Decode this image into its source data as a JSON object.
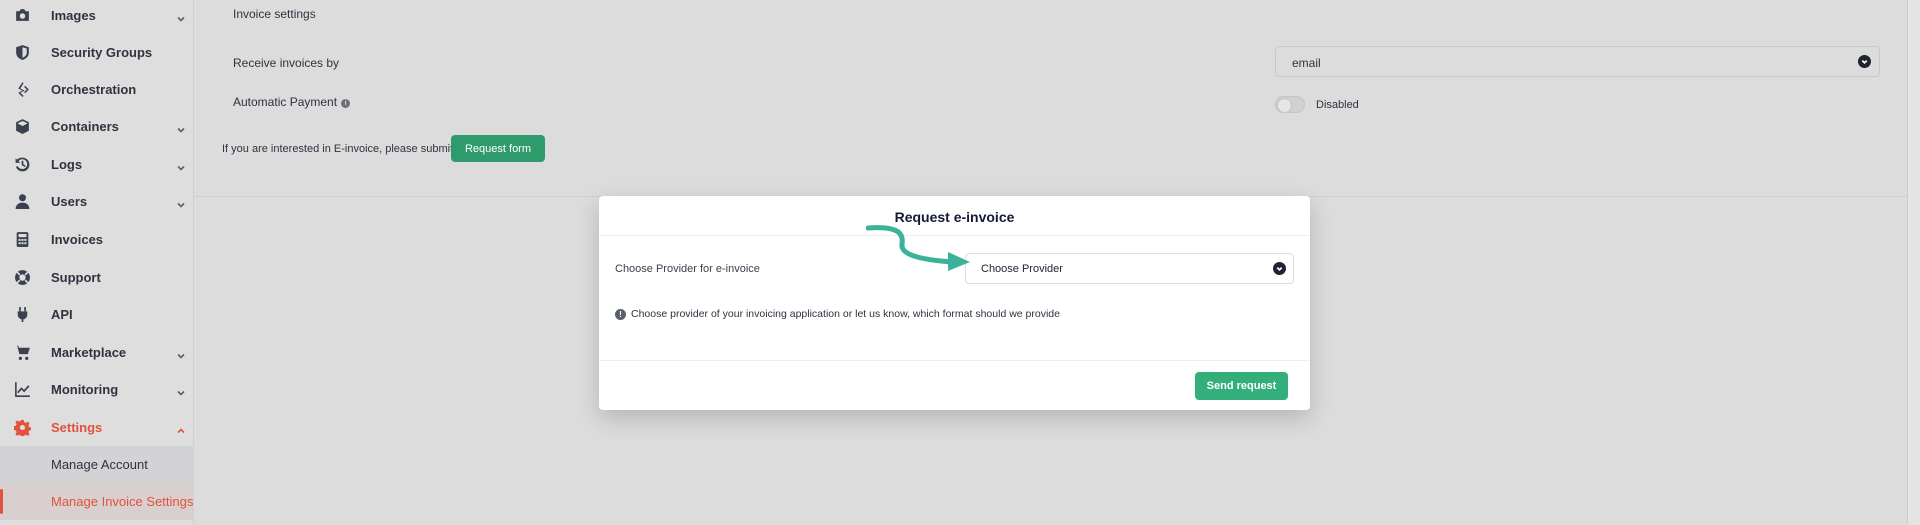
{
  "sidebar": {
    "items": [
      {
        "label": "Images",
        "icon": "camera-icon",
        "has_chevron": true
      },
      {
        "label": "Security Groups",
        "icon": "shield-icon",
        "has_chevron": false
      },
      {
        "label": "Orchestration",
        "icon": "orchestration-icon",
        "has_chevron": false
      },
      {
        "label": "Containers",
        "icon": "cube-icon",
        "has_chevron": true
      },
      {
        "label": "Logs",
        "icon": "history-icon",
        "has_chevron": true
      },
      {
        "label": "Users",
        "icon": "user-icon",
        "has_chevron": true
      },
      {
        "label": "Invoices",
        "icon": "calculator-icon",
        "has_chevron": false
      },
      {
        "label": "Support",
        "icon": "lifebuoy-icon",
        "has_chevron": false
      },
      {
        "label": "API",
        "icon": "plug-icon",
        "has_chevron": false
      },
      {
        "label": "Marketplace",
        "icon": "cart-icon",
        "has_chevron": true
      },
      {
        "label": "Monitoring",
        "icon": "chart-line-icon",
        "has_chevron": true
      },
      {
        "label": "Settings",
        "icon": "gear-icon",
        "has_chevron": true,
        "active": true
      }
    ],
    "sub_items": [
      {
        "label": "Manage Account"
      },
      {
        "label": "Manage Invoice Settings",
        "active": true
      }
    ]
  },
  "settings": {
    "section_title": "Invoice settings",
    "receive_label": "Receive invoices by",
    "receive_value": "email",
    "auto_payment_label": "Automatic Payment",
    "auto_payment_status": "Disabled",
    "einvoice_text": "If you are interested in E-invoice, please submit",
    "request_form_button": "Request form"
  },
  "modal": {
    "title": "Request e-invoice",
    "provider_label": "Choose Provider for e-invoice",
    "provider_value": "Choose Provider",
    "info_text": "Choose provider of your invoicing application or let us know, which format should we provide",
    "send_button": "Send request"
  },
  "colors": {
    "accent_green": "#34ae7b",
    "active_red": "#e0533d",
    "annotation_arrow": "#3bb39b"
  }
}
